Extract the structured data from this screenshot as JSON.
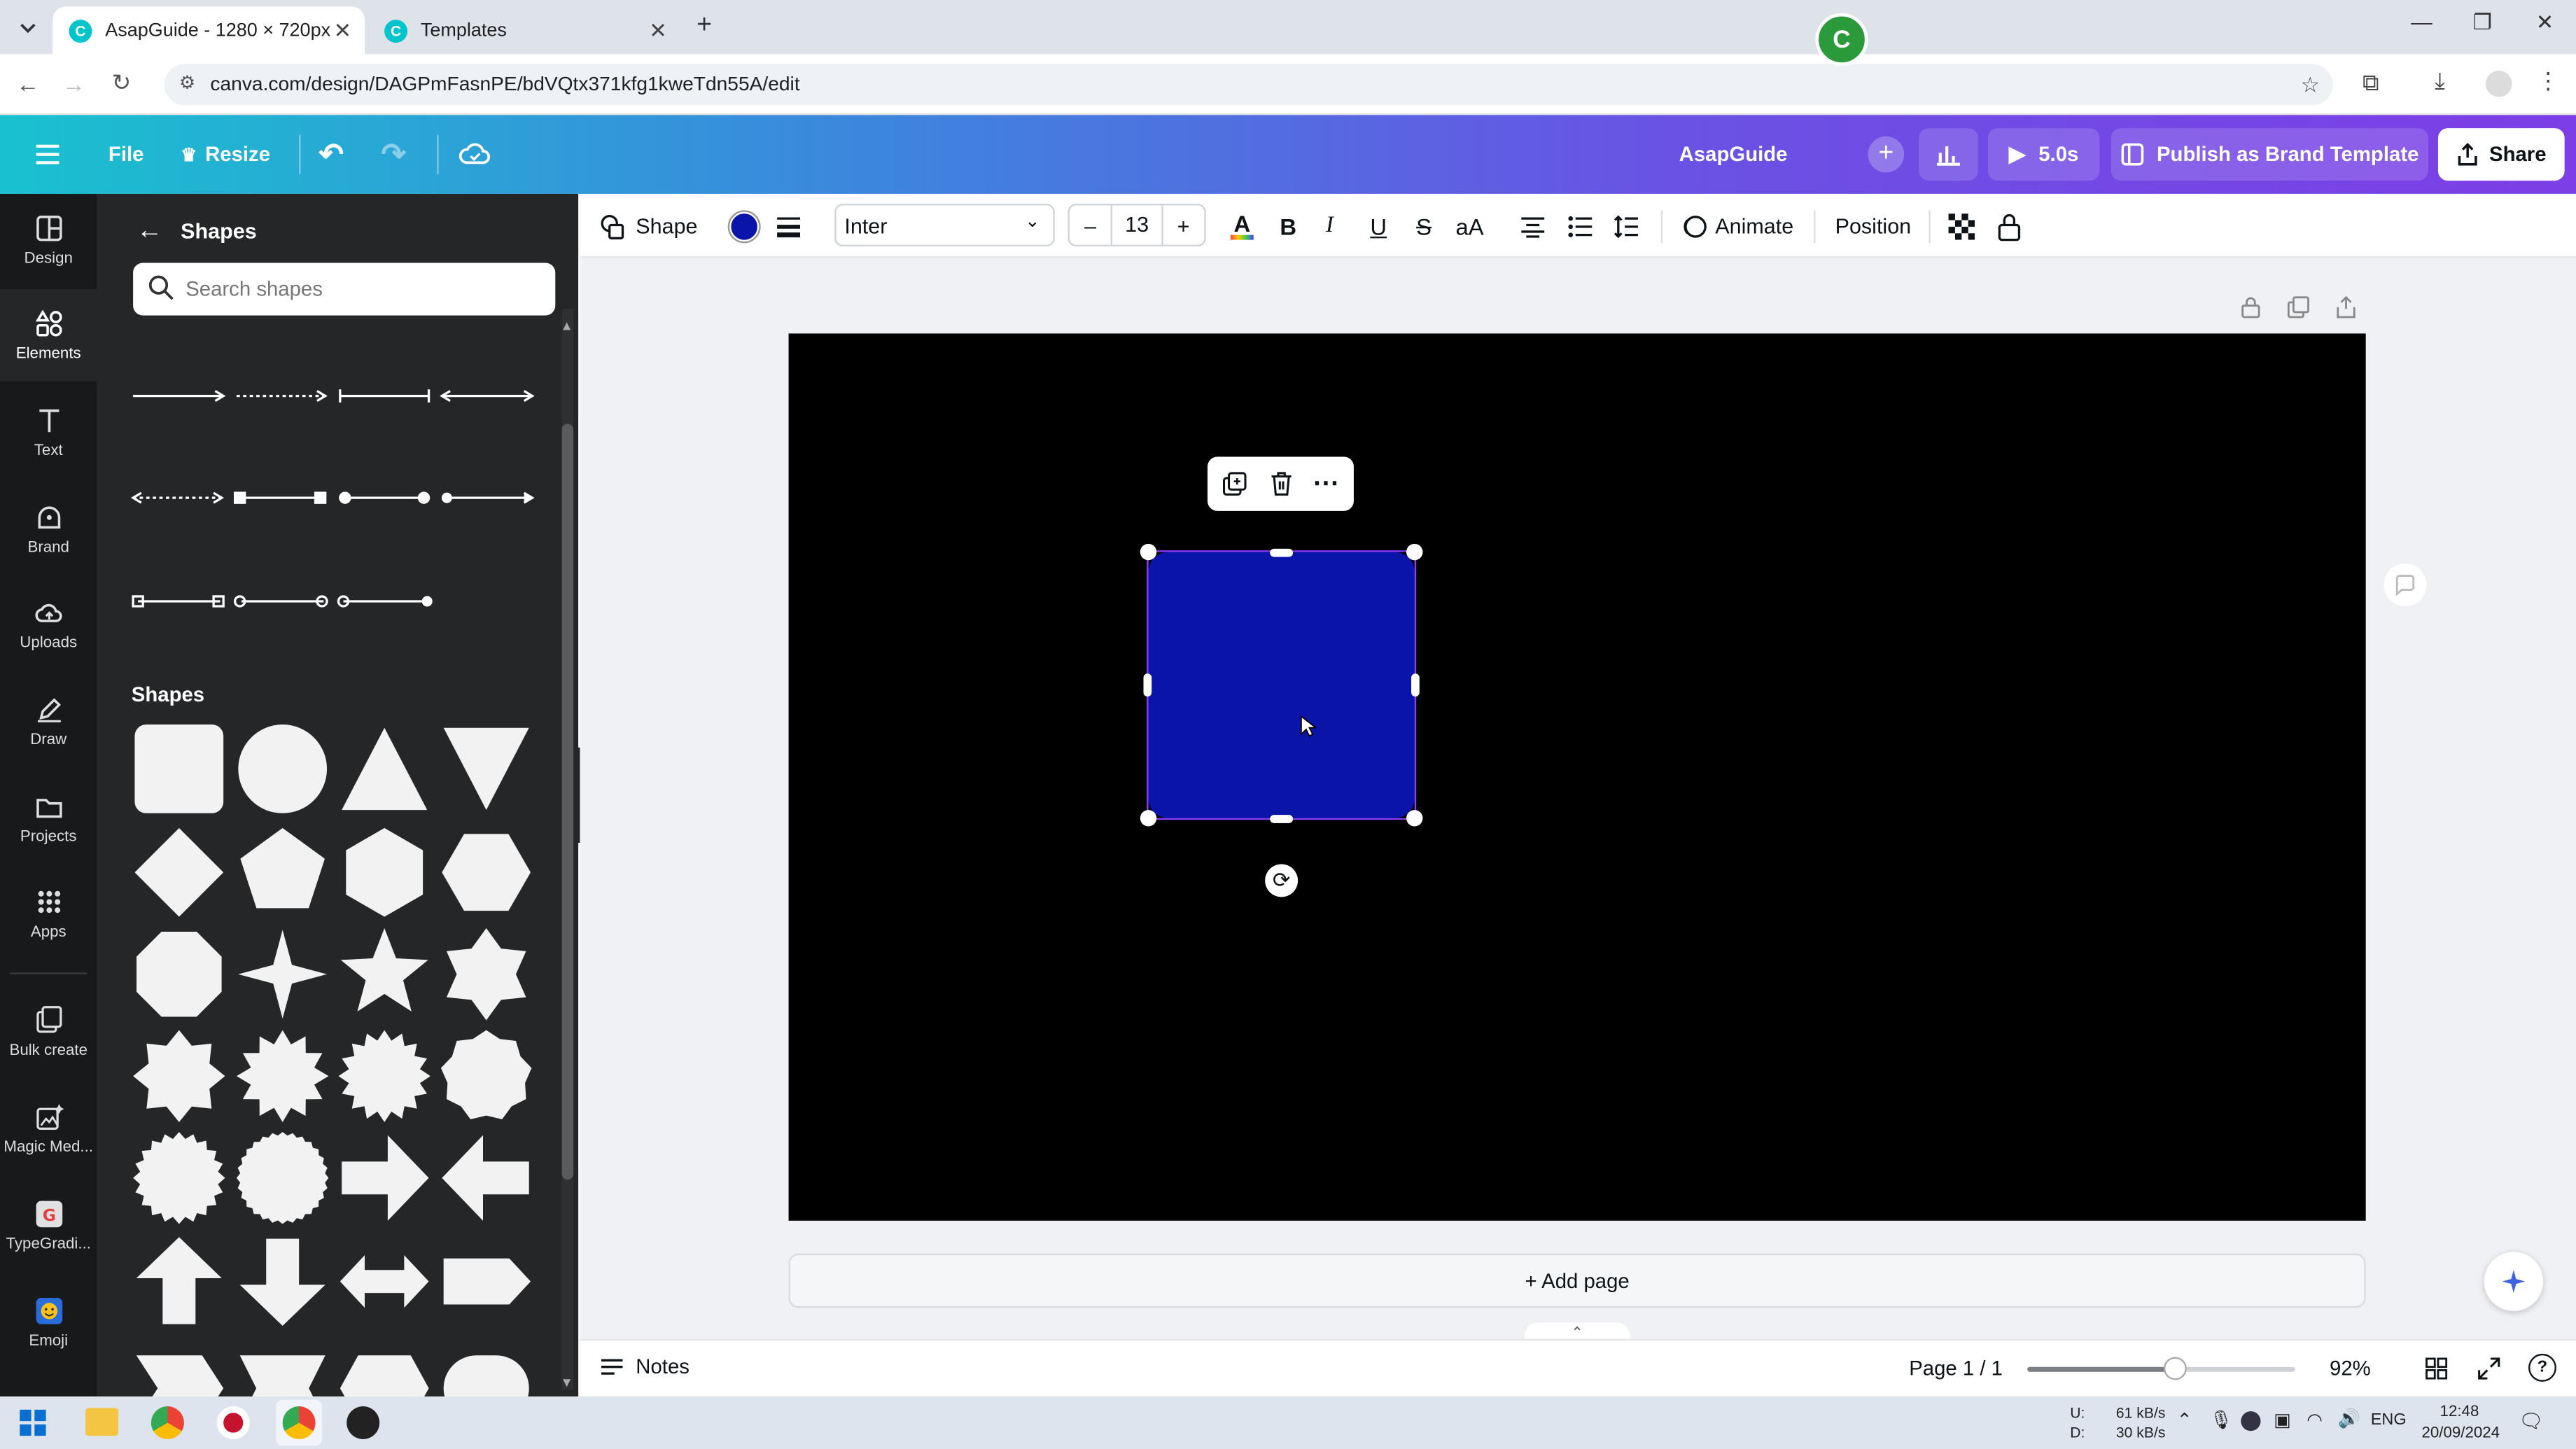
{
  "browser": {
    "tabs": [
      {
        "title": "AsapGuide - 1280 × 720px",
        "active": true
      },
      {
        "title": "Templates",
        "active": false
      }
    ],
    "url": "canva.com/design/DAGPmFasnPE/bdVQtx371kfg1kweTdn55A/edit"
  },
  "header": {
    "file_label": "File",
    "resize_label": "Resize",
    "design_name": "AsapGuide",
    "avatar_letter": "C",
    "play_label": "5.0s",
    "publish_label": "Publish as Brand Template",
    "share_label": "Share"
  },
  "rail": {
    "items": [
      {
        "label": "Design",
        "icon": "layout-icon"
      },
      {
        "label": "Elements",
        "icon": "elements-icon"
      },
      {
        "label": "Text",
        "icon": "text-icon"
      },
      {
        "label": "Brand",
        "icon": "brand-icon"
      },
      {
        "label": "Uploads",
        "icon": "cloud-upload-icon"
      },
      {
        "label": "Draw",
        "icon": "pen-icon"
      },
      {
        "label": "Projects",
        "icon": "folder-icon"
      },
      {
        "label": "Apps",
        "icon": "apps-grid-icon"
      },
      {
        "label": "Bulk create",
        "icon": "bulk-create-icon"
      },
      {
        "label": "Magic Med...",
        "icon": "magic-media-icon"
      },
      {
        "label": "TypeGradi...",
        "icon": "typegradient-icon"
      },
      {
        "label": "Emoji",
        "icon": "emoji-icon"
      }
    ]
  },
  "panel": {
    "title": "Shapes",
    "search_placeholder": "Search shapes",
    "shapes_heading": "Shapes"
  },
  "toolbar": {
    "shape_label": "Shape",
    "fill_color": "#0a14a8",
    "font_name": "Inter",
    "font_size": "13",
    "animate_label": "Animate",
    "position_label": "Position"
  },
  "canvas": {
    "background": "#000000",
    "selected_shape_color": "#0a14a8",
    "add_page_label": "+ Add page"
  },
  "bottom": {
    "notes_label": "Notes",
    "page_label": "Page 1 / 1",
    "zoom_label": "92%",
    "zoom_fraction": 0.55
  },
  "taskbar": {
    "net_up_label": "U:",
    "net_down_label": "D:",
    "net_up": "61 kB/s",
    "net_down": "30 kB/s",
    "lang": "ENG",
    "time": "12:48",
    "date": "20/09/2024"
  }
}
